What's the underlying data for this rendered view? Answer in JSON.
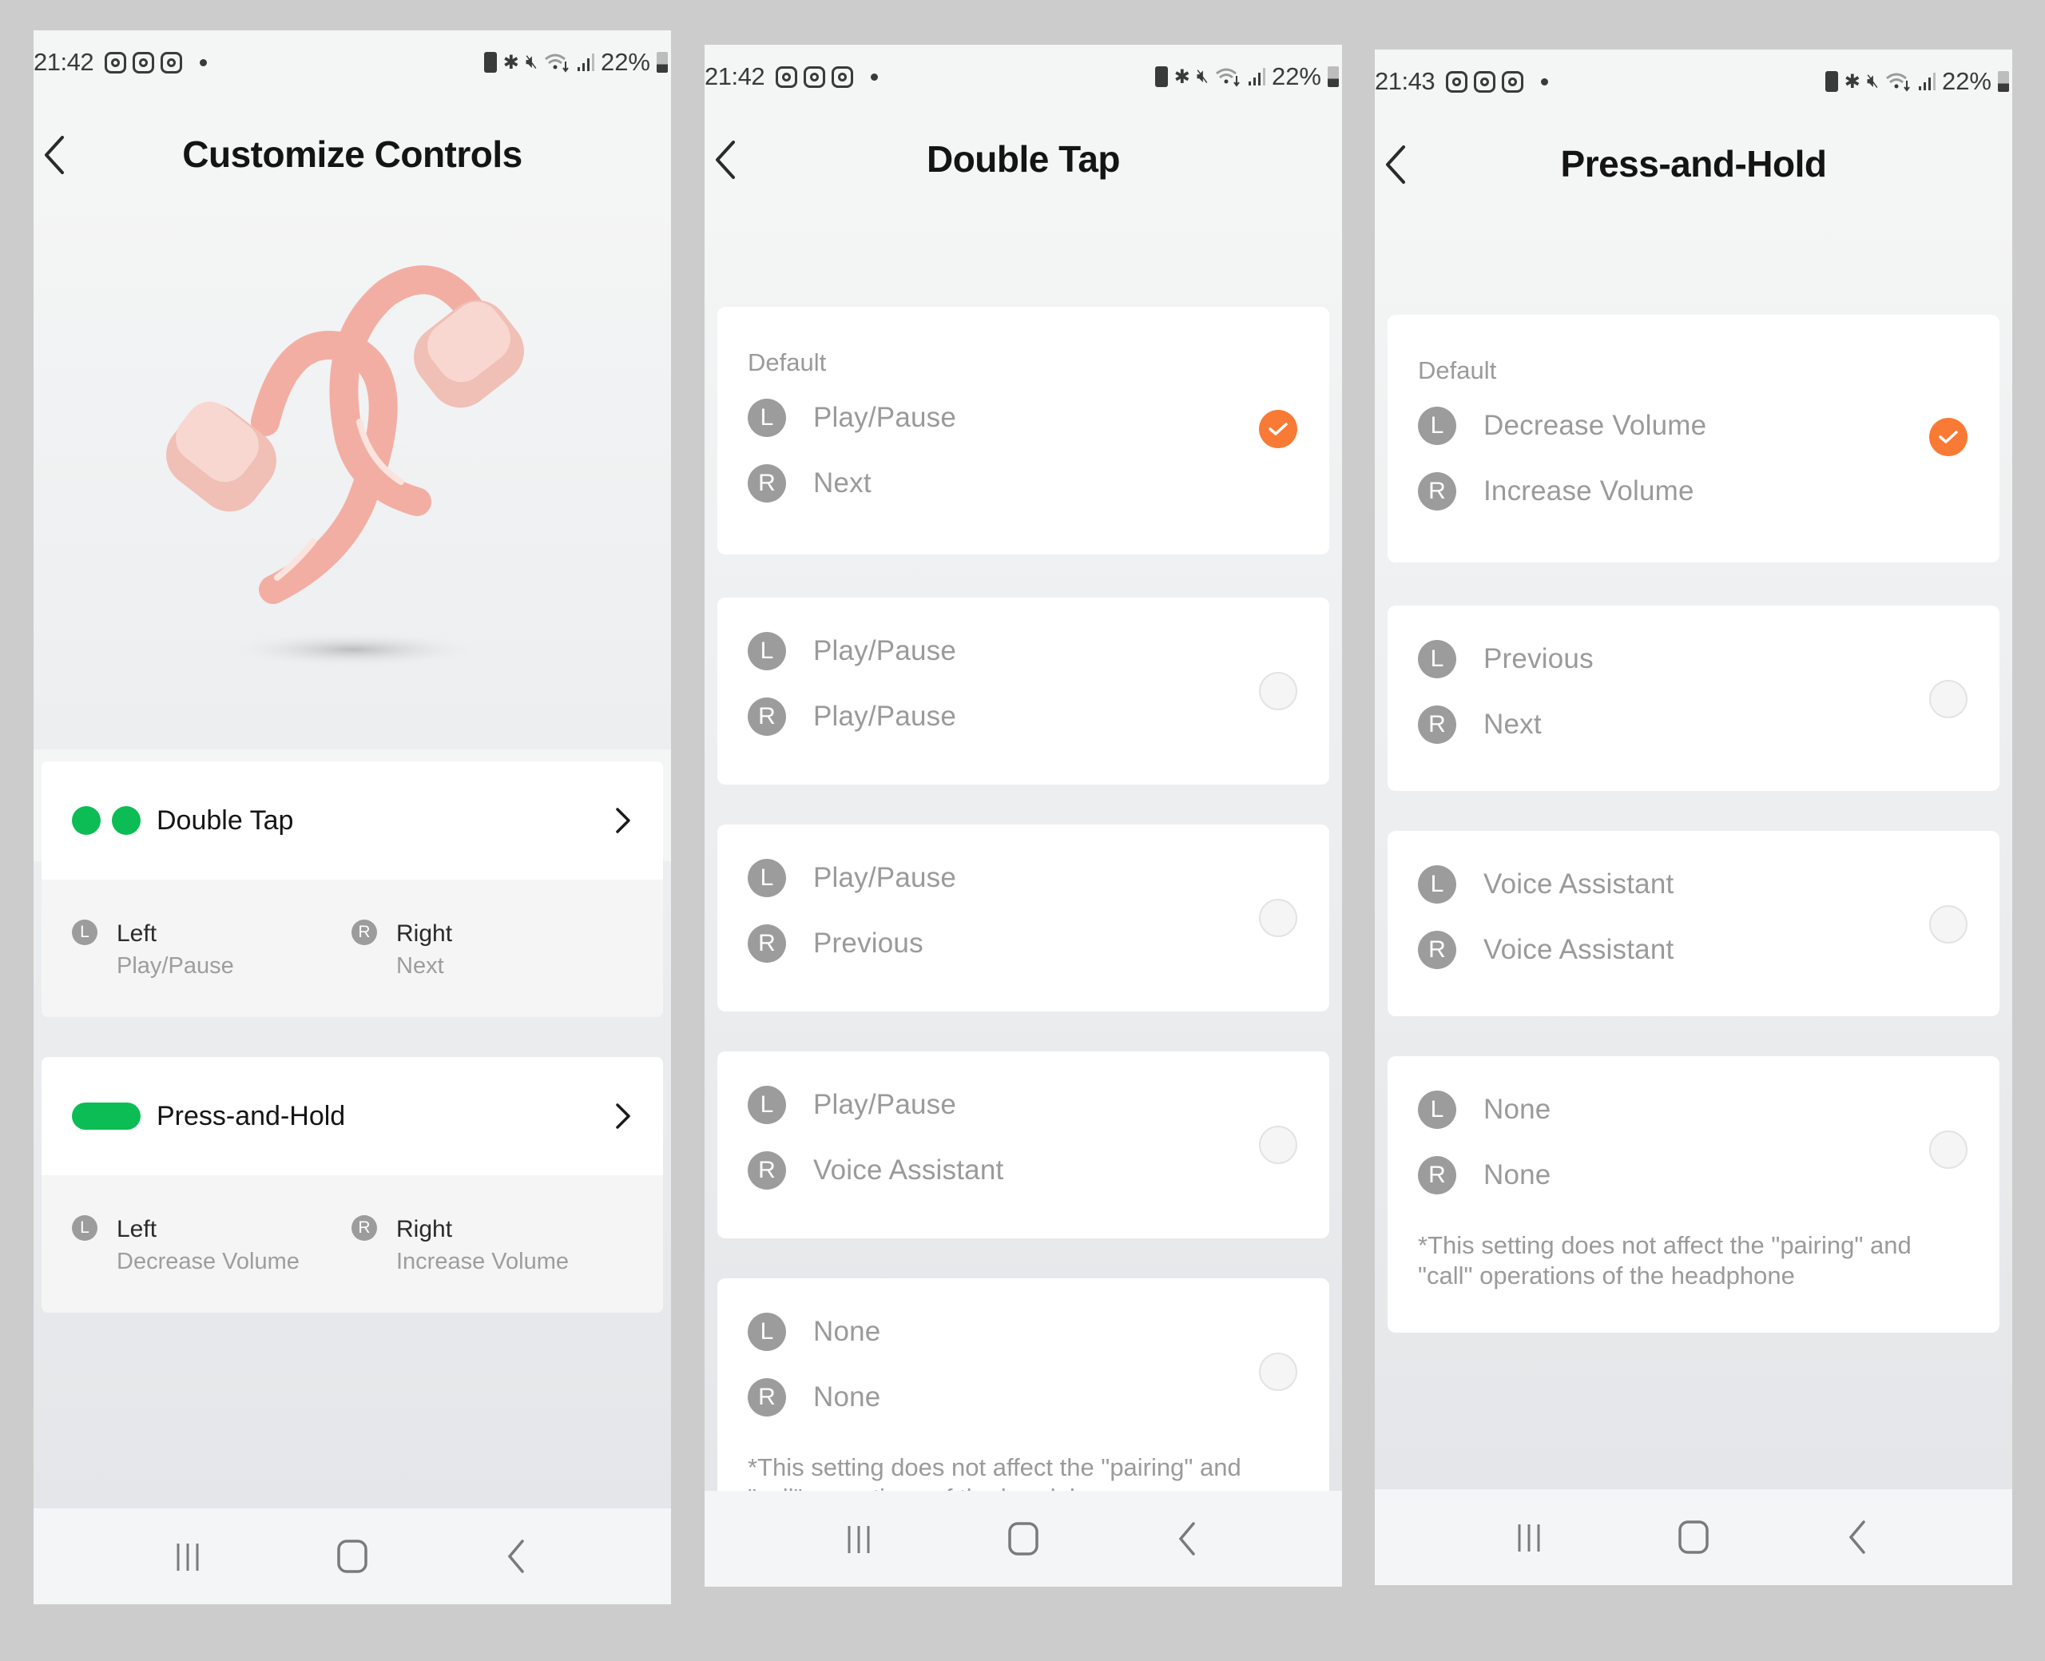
{
  "colors": {
    "accent_green": "#0bbd54",
    "selected_orange": "#f97a35",
    "badge_gray": "#9c9c9c",
    "backdrop": "#cccccc"
  },
  "screens": [
    {
      "id": "customize-controls",
      "status": {
        "time": "21:42",
        "battery": "22%"
      },
      "title": "Customize Controls",
      "product_image": "Shokz open-ear earbuds (pink)",
      "controls": [
        {
          "label": "Double Tap",
          "indicator": "double-dot",
          "left_label": "Left",
          "left_badge": "L",
          "left_action": "Play/Pause",
          "right_label": "Right",
          "right_badge": "R",
          "right_action": "Next"
        },
        {
          "label": "Press-and-Hold",
          "indicator": "pill",
          "left_label": "Left",
          "left_badge": "L",
          "left_action": "Decrease Volume",
          "right_label": "Right",
          "right_badge": "R",
          "right_action": "Increase Volume"
        }
      ]
    },
    {
      "id": "double-tap",
      "status": {
        "time": "21:42",
        "battery": "22%"
      },
      "title": "Double Tap",
      "default_label": "Default",
      "options": [
        {
          "left": "Play/Pause",
          "right": "Next",
          "selected": true,
          "is_default": true
        },
        {
          "left": "Play/Pause",
          "right": "Play/Pause",
          "selected": false
        },
        {
          "left": "Play/Pause",
          "right": "Previous",
          "selected": false
        },
        {
          "left": "Play/Pause",
          "right": "Voice Assistant",
          "selected": false
        },
        {
          "left": "None",
          "right": "None",
          "selected": false
        }
      ],
      "footnote": "*This setting does not affect the \"pairing\" and \"call\" operations of the headphone"
    },
    {
      "id": "press-and-hold",
      "status": {
        "time": "21:43",
        "battery": "22%"
      },
      "title": "Press-and-Hold",
      "default_label": "Default",
      "options": [
        {
          "left": "Decrease Volume",
          "right": "Increase Volume",
          "selected": true,
          "is_default": true
        },
        {
          "left": "Previous",
          "right": "Next",
          "selected": false
        },
        {
          "left": "Voice Assistant",
          "right": "Voice Assistant",
          "selected": false
        },
        {
          "left": "None",
          "right": "None",
          "selected": false
        }
      ],
      "footnote": "*This setting does not affect the \"pairing\" and \"call\" operations of the headphone"
    }
  ],
  "badges": {
    "left": "L",
    "right": "R"
  },
  "navbar": [
    "recent-apps",
    "home",
    "back"
  ]
}
